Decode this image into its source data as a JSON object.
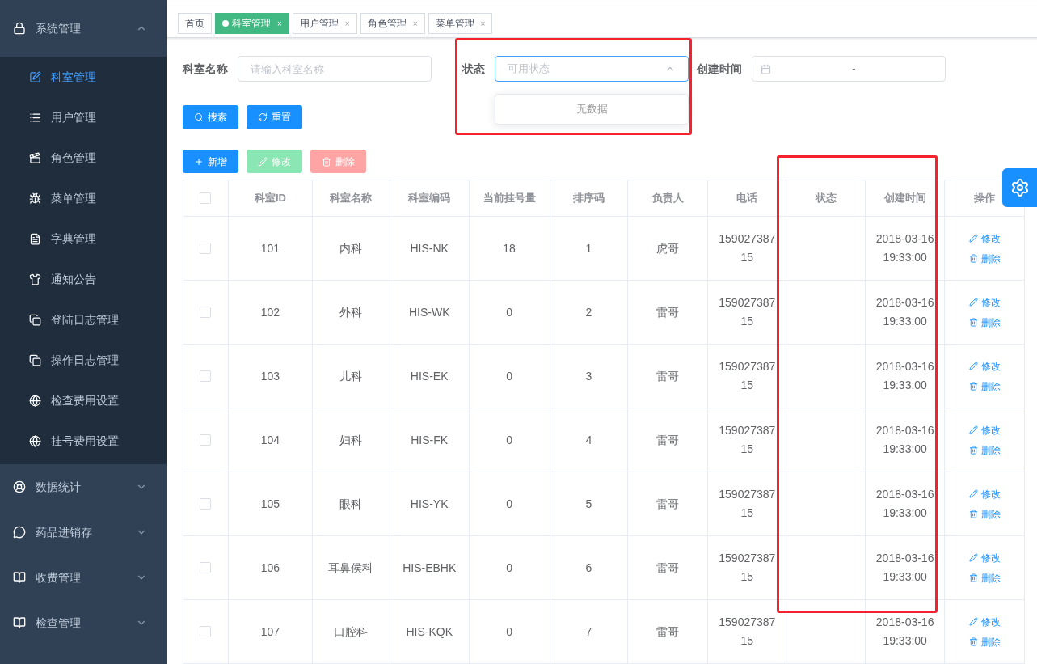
{
  "sidebar": {
    "groups": [
      {
        "label": "系统管理",
        "expanded": true,
        "children": [
          {
            "label": "科室管理",
            "selected": true
          },
          {
            "label": "用户管理",
            "selected": false
          },
          {
            "label": "角色管理",
            "selected": false
          },
          {
            "label": "菜单管理",
            "selected": false
          },
          {
            "label": "字典管理",
            "selected": false
          },
          {
            "label": "通知公告",
            "selected": false
          },
          {
            "label": "登陆日志管理",
            "selected": false
          },
          {
            "label": "操作日志管理",
            "selected": false
          },
          {
            "label": "检查费用设置",
            "selected": false
          },
          {
            "label": "挂号费用设置",
            "selected": false
          }
        ]
      },
      {
        "label": "数据统计",
        "expanded": false
      },
      {
        "label": "药品进销存",
        "expanded": false
      },
      {
        "label": "收费管理",
        "expanded": false
      },
      {
        "label": "检查管理",
        "expanded": false
      }
    ]
  },
  "tabs": [
    {
      "label": "首页",
      "selected": false,
      "closable": false
    },
    {
      "label": "科室管理",
      "selected": true,
      "closable": true
    },
    {
      "label": "用户管理",
      "selected": false,
      "closable": true
    },
    {
      "label": "角色管理",
      "selected": false,
      "closable": true
    },
    {
      "label": "菜单管理",
      "selected": false,
      "closable": true
    }
  ],
  "close_mark": "×",
  "filters": {
    "name_label": "科室名称",
    "name_placeholder": "请输入科室名称",
    "status_label": "状态",
    "status_placeholder": "可用状态",
    "status_expanded": true,
    "status_empty": "无数据",
    "time_label": "创建时间",
    "time_separator": "-"
  },
  "search_buttons": [
    "搜索",
    "重置"
  ],
  "actions": [
    {
      "label": "新增",
      "disabled": false,
      "kind": "add"
    },
    {
      "label": "修改",
      "disabled": true,
      "kind": "edit"
    },
    {
      "label": "删除",
      "disabled": true,
      "kind": "delete"
    }
  ],
  "table": {
    "all_checked": false,
    "columns": [
      "科室ID",
      "科室名称",
      "科室编码",
      "当前挂号量",
      "排序码",
      "负责人",
      "电话",
      "状态",
      "创建时间",
      "操作"
    ],
    "rows": [
      {
        "checked": false,
        "cells": [
          "101",
          "内科",
          "HIS-NK",
          "18",
          "1",
          "虎哥",
          "15902738715",
          "",
          "2018-03-16 19:33:00"
        ],
        "actions": [
          "修改",
          "删除"
        ]
      },
      {
        "checked": false,
        "cells": [
          "102",
          "外科",
          "HIS-WK",
          "0",
          "2",
          "雷哥",
          "15902738715",
          "",
          "2018-03-16 19:33:00"
        ],
        "actions": [
          "修改",
          "删除"
        ]
      },
      {
        "checked": false,
        "cells": [
          "103",
          "儿科",
          "HIS-EK",
          "0",
          "3",
          "雷哥",
          "15902738715",
          "",
          "2018-03-16 19:33:00"
        ],
        "actions": [
          "修改",
          "删除"
        ]
      },
      {
        "checked": false,
        "cells": [
          "104",
          "妇科",
          "HIS-FK",
          "0",
          "4",
          "雷哥",
          "15902738715",
          "",
          "2018-03-16 19:33:00"
        ],
        "actions": [
          "修改",
          "删除"
        ]
      },
      {
        "checked": false,
        "cells": [
          "105",
          "眼科",
          "HIS-YK",
          "0",
          "5",
          "雷哥",
          "15902738715",
          "",
          "2018-03-16 19:33:00"
        ],
        "actions": [
          "修改",
          "删除"
        ]
      },
      {
        "checked": false,
        "cells": [
          "106",
          "耳鼻侯科",
          "HIS-EBHK",
          "0",
          "6",
          "雷哥",
          "15902738715",
          "",
          "2018-03-16 19:33:00"
        ],
        "actions": [
          "修改",
          "删除"
        ]
      },
      {
        "checked": false,
        "cells": [
          "107",
          "口腔科",
          "HIS-KQK",
          "0",
          "7",
          "雷哥",
          "15902738715",
          "",
          "2018-03-16 19:33:00"
        ],
        "actions": [
          "修改",
          "删除"
        ]
      }
    ]
  }
}
